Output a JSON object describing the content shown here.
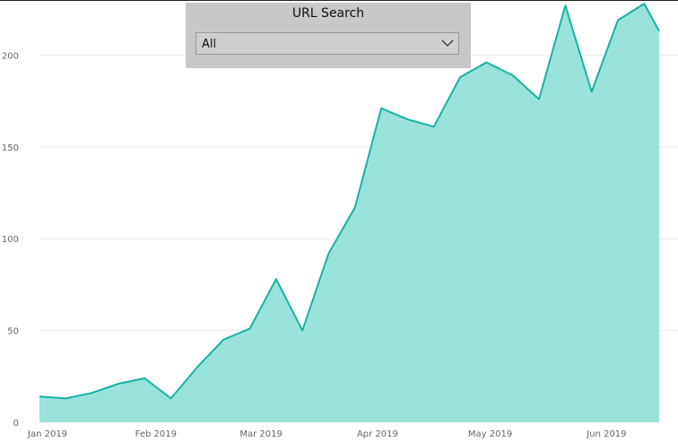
{
  "slicer": {
    "title": "URL Search",
    "selected": "All",
    "dropdown_icon": "chevron-down-icon"
  },
  "colors": {
    "area_fill": "#9ae3db",
    "line": "#15b3a5",
    "grid": "#e9e9e9",
    "slicer_bg": "#c8c8c8"
  },
  "chart_data": {
    "type": "area",
    "title": "",
    "xlabel": "",
    "ylabel": "",
    "ylim": [
      0,
      230
    ],
    "yticks": [
      "0",
      "50",
      "100",
      "150",
      "200"
    ],
    "xlim": [
      "2019-01-01",
      "2019-06-20"
    ],
    "xticks": [
      {
        "date": "2019-01-01",
        "label": "Jan 2019"
      },
      {
        "date": "2019-02-01",
        "label": "Feb 2019"
      },
      {
        "date": "2019-03-01",
        "label": "Mar 2019"
      },
      {
        "date": "2019-04-01",
        "label": "Apr 2019"
      },
      {
        "date": "2019-05-01",
        "label": "May 2019"
      },
      {
        "date": "2019-06-01",
        "label": "Jun 2019"
      }
    ],
    "grid": true,
    "series": [
      {
        "x": [
          "2019-01-01",
          "2019-01-08",
          "2019-01-15",
          "2019-01-22",
          "2019-01-29",
          "2019-02-05",
          "2019-02-12",
          "2019-02-19",
          "2019-02-26",
          "2019-03-05",
          "2019-03-12",
          "2019-03-19",
          "2019-03-26",
          "2019-04-02",
          "2019-04-09",
          "2019-04-16",
          "2019-04-23",
          "2019-04-30",
          "2019-05-07",
          "2019-05-14",
          "2019-05-21",
          "2019-05-28",
          "2019-06-04",
          "2019-06-11",
          "2019-06-15"
        ],
        "values": [
          14,
          13,
          16,
          21,
          24,
          13,
          30,
          45,
          51,
          78,
          50,
          92,
          117,
          171,
          165,
          161,
          188,
          196,
          189,
          176,
          227,
          180,
          219,
          228,
          213
        ]
      }
    ]
  }
}
